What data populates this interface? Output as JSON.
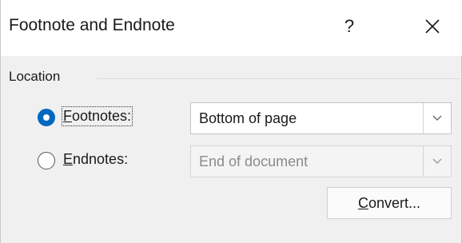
{
  "window": {
    "title": "Footnote and Endnote"
  },
  "titlebar": {
    "help_label": "?"
  },
  "location": {
    "label": "Location",
    "footnotes": {
      "label_prefix": "",
      "label_mnemonic": "F",
      "label_rest": "ootnotes:",
      "selected": true,
      "value": "Bottom of page"
    },
    "endnotes": {
      "label_prefix": "",
      "label_mnemonic": "E",
      "label_rest": "ndnotes:",
      "selected": false,
      "value": "End of document"
    }
  },
  "convert_button": {
    "label_prefix": "",
    "label_mnemonic": "C",
    "label_rest": "onvert..."
  },
  "icons": {
    "close": "close-icon",
    "dropdown": "chevron-down-icon"
  },
  "colors": {
    "accent": "#0067c0",
    "titlebar_bg": "#ffffff",
    "dialog_bg": "#f0f0f0",
    "disabled_text": "#8a8a8a"
  }
}
